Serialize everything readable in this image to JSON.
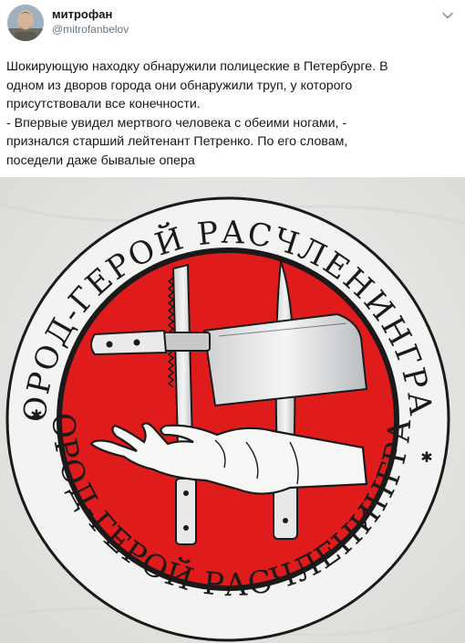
{
  "author": {
    "display_name": "митрофан",
    "handle": "@mitrofanbelov"
  },
  "tweet": {
    "lines": [
      "Шокирующую находку обнаружили полицеские в Петербурге. В",
      "одном из дворов города они обнаружили труп, у которого",
      "присутствовали все конечности.",
      "- Впервые увидел мертвого человека с обеими ногами, -",
      "признался старший лейтенант Петренко. По его словам,",
      "поседели даже бывалые опера"
    ]
  },
  "emblem": {
    "ring_text_top": "ГОРОД-ГЕРОЙ РАСЧЛЕНИНГРАД",
    "ring_text_bottom": "ГОРОД-ГЕРОЙ РАСЧЛЕНИНГРАД",
    "ring_separator": "✱",
    "colors": {
      "disc": "#e01b1b",
      "ink": "#1a1a1a",
      "shirt": "#e9eae7"
    }
  },
  "icons": {
    "menu": "chevron-down-icon"
  }
}
